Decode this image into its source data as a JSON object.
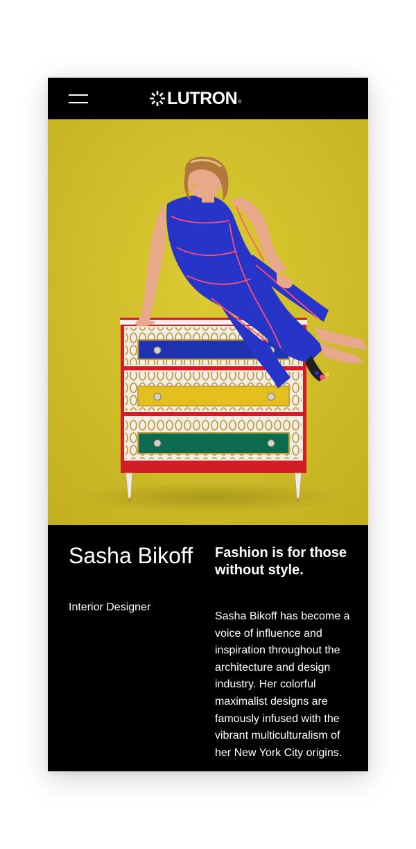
{
  "header": {
    "menu_icon": "hamburger-icon",
    "brand_icon": "lutron-burst-icon",
    "brand_name": "LUTRON",
    "brand_mark": "®"
  },
  "hero": {
    "background_color": "#d0bd2a"
  },
  "profile": {
    "name": "Sasha Bikoff",
    "role": "Interior Designer",
    "headline": "Fashion is for those without style.",
    "body": "Sasha Bikoff has become a voice of influence and inspiration throughout the architecture and design industry. Her colorful maximalist designs are famously infused with the vibrant multiculturalism of her New York City origins."
  }
}
